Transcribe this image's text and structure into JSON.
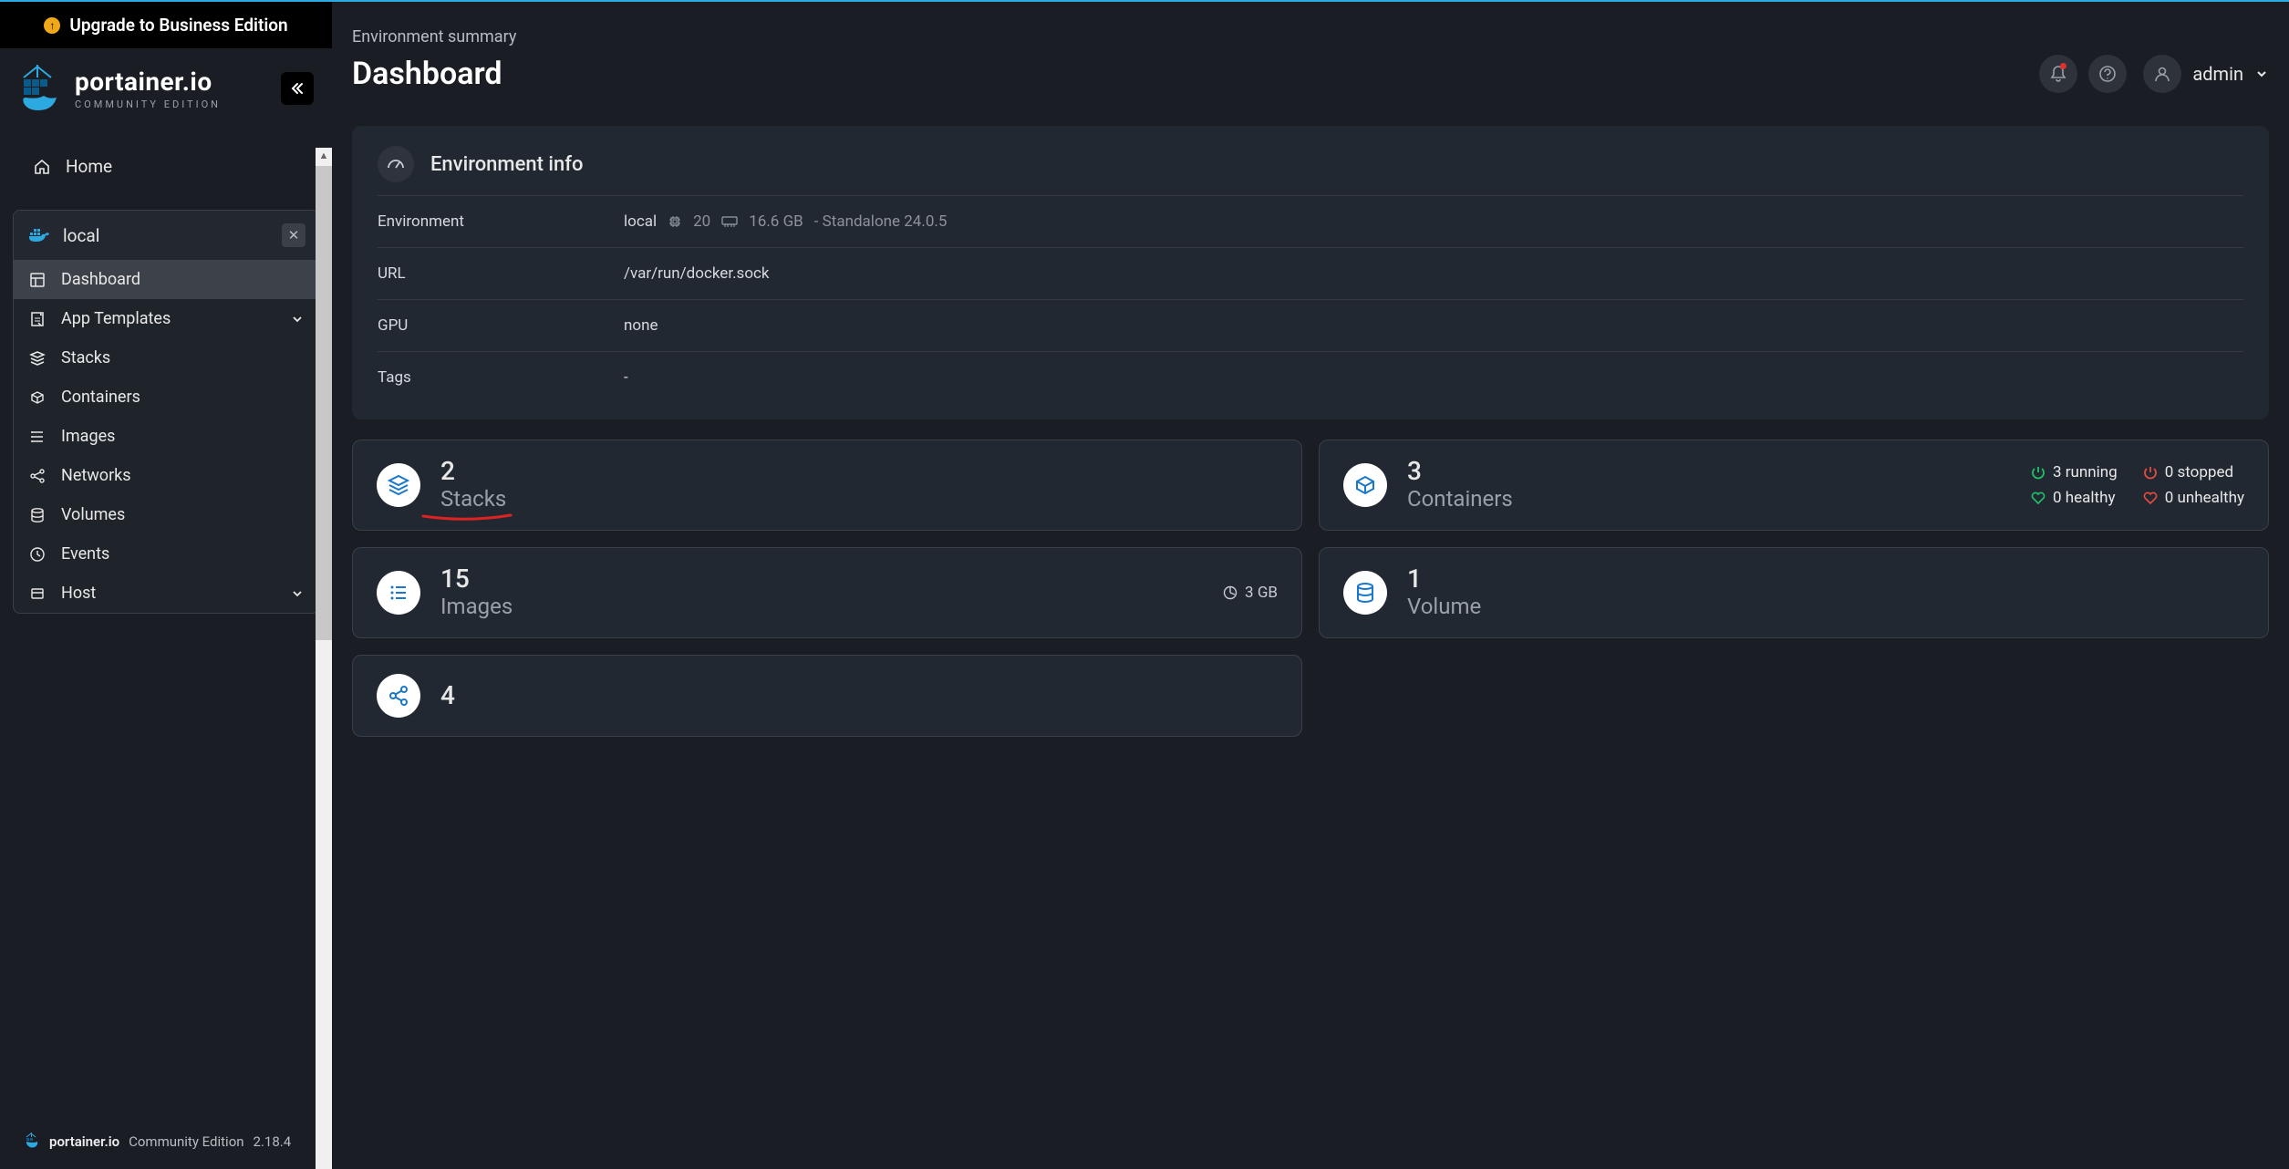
{
  "upgrade_banner": "Upgrade to Business Edition",
  "logo": {
    "brand": "portainer.io",
    "edition": "COMMUNITY EDITION"
  },
  "home_label": "Home",
  "environment_name": "local",
  "nav": {
    "dashboard": "Dashboard",
    "app_templates": "App Templates",
    "stacks": "Stacks",
    "containers": "Containers",
    "images": "Images",
    "networks": "Networks",
    "volumes": "Volumes",
    "events": "Events",
    "host": "Host"
  },
  "footer": {
    "brand": "portainer.io",
    "edition": "Community Edition",
    "version": "2.18.4"
  },
  "breadcrumb": "Environment summary",
  "page_title": "Dashboard",
  "user": {
    "name": "admin"
  },
  "env_info": {
    "title": "Environment info",
    "rows": {
      "environment_label": "Environment",
      "environment_value": "local",
      "cpu_count": "20",
      "memory": "16.6 GB",
      "mode": "- Standalone 24.0.5",
      "url_label": "URL",
      "url_value": "/var/run/docker.sock",
      "gpu_label": "GPU",
      "gpu_value": "none",
      "tags_label": "Tags",
      "tags_value": "-"
    }
  },
  "tiles": {
    "stacks": {
      "count": "2",
      "label": "Stacks"
    },
    "containers": {
      "count": "3",
      "label": "Containers",
      "running": "3 running",
      "stopped": "0 stopped",
      "healthy": "0 healthy",
      "unhealthy": "0 unhealthy"
    },
    "images": {
      "count": "15",
      "label": "Images",
      "size": "3 GB"
    },
    "volumes": {
      "count": "1",
      "label": "Volume"
    },
    "networks": {
      "count": "4"
    }
  }
}
